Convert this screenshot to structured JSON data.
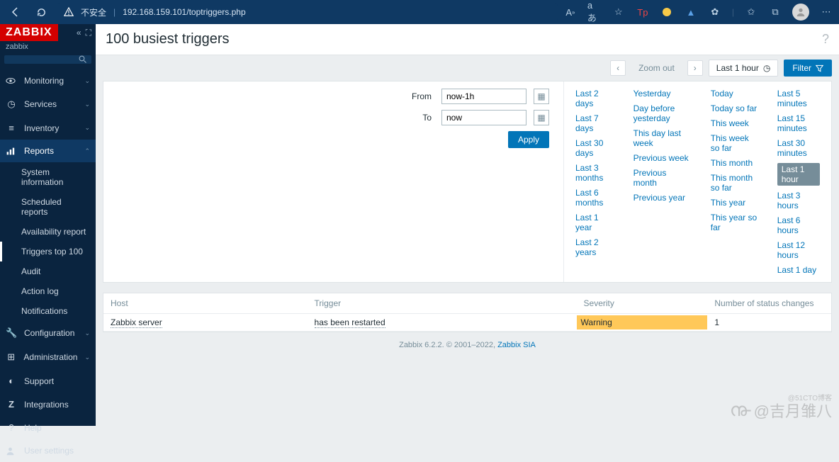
{
  "browser": {
    "insecure": "不安全",
    "url": "192.168.159.101/toptriggers.php"
  },
  "sidebar": {
    "logo": "ZABBIX",
    "sub": "zabbix",
    "items": [
      {
        "icon": "👁",
        "label": "Monitoring"
      },
      {
        "icon": "◷",
        "label": "Services"
      },
      {
        "icon": "≡",
        "label": "Inventory"
      },
      {
        "icon": "▥",
        "label": "Reports"
      },
      {
        "icon": "🔧",
        "label": "Configuration"
      },
      {
        "icon": "▦",
        "label": "Administration"
      }
    ],
    "report_sub": [
      "System information",
      "Scheduled reports",
      "Availability report",
      "Triggers top 100",
      "Audit",
      "Action log",
      "Notifications"
    ],
    "bottom": [
      {
        "icon": "◑",
        "label": "Support"
      },
      {
        "icon": "Z",
        "label": "Integrations"
      },
      {
        "icon": "?",
        "label": "Help"
      },
      {
        "icon": "👤",
        "label": "User settings"
      }
    ]
  },
  "page": {
    "title": "100 busiest triggers"
  },
  "filterbar": {
    "zoomout": "Zoom out",
    "tab": "Last 1 hour",
    "filter": "Filter"
  },
  "filter": {
    "from_label": "From",
    "from_value": "now-1h",
    "to_label": "To",
    "to_value": "now",
    "apply": "Apply",
    "presets": [
      [
        "Last 2 days",
        "Last 7 days",
        "Last 30 days",
        "Last 3 months",
        "Last 6 months",
        "Last 1 year",
        "Last 2 years"
      ],
      [
        "Yesterday",
        "Day before yesterday",
        "This day last week",
        "Previous week",
        "Previous month",
        "Previous year"
      ],
      [
        "Today",
        "Today so far",
        "This week",
        "This week so far",
        "This month",
        "This month so far",
        "This year",
        "This year so far"
      ],
      [
        "Last 5 minutes",
        "Last 15 minutes",
        "Last 30 minutes",
        "Last 1 hour",
        "Last 3 hours",
        "Last 6 hours",
        "Last 12 hours",
        "Last 1 day"
      ]
    ],
    "selected": "Last 1 hour"
  },
  "table": {
    "headers": [
      "Host",
      "Trigger",
      "Severity",
      "Number of status changes"
    ],
    "rows": [
      {
        "host": "Zabbix server",
        "trigger": "has been restarted",
        "severity": "Warning",
        "changes": "1"
      }
    ]
  },
  "footer": {
    "text": "Zabbix 6.2.2. © 2001–2022, ",
    "link": "Zabbix SIA"
  },
  "watermark": {
    "main": "@吉月雏八",
    "sub": "@51CTO博客"
  }
}
